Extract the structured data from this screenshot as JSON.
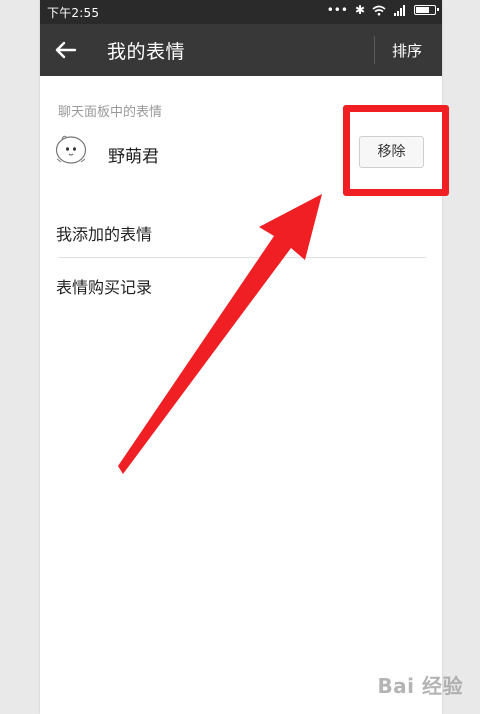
{
  "status_bar": {
    "time": "下午2:55",
    "icons": [
      "more-icon",
      "bluetooth-icon",
      "wifi-icon",
      "signal-icon",
      "battery-icon"
    ],
    "battery_level": 0.75
  },
  "header": {
    "title": "我的表情",
    "back_icon": "back-arrow-icon",
    "sort_label": "排序"
  },
  "chat_panel_section": {
    "label": "聊天面板中的表情",
    "items": [
      {
        "name": "野萌君",
        "icon": "sticker-thumbnail-icon",
        "action_label": "移除"
      }
    ]
  },
  "menu": {
    "items": [
      {
        "label": "我添加的表情"
      },
      {
        "label": "表情购买记录"
      }
    ]
  },
  "annotation": {
    "color": "#ef1f24"
  },
  "watermark": {
    "text": "Bai 经验"
  },
  "colors": {
    "status_bar_bg": "#2a2a2a",
    "app_bar_bg": "#383838",
    "page_bg": "#ffffff",
    "frame_bg": "#e9e9e9"
  }
}
